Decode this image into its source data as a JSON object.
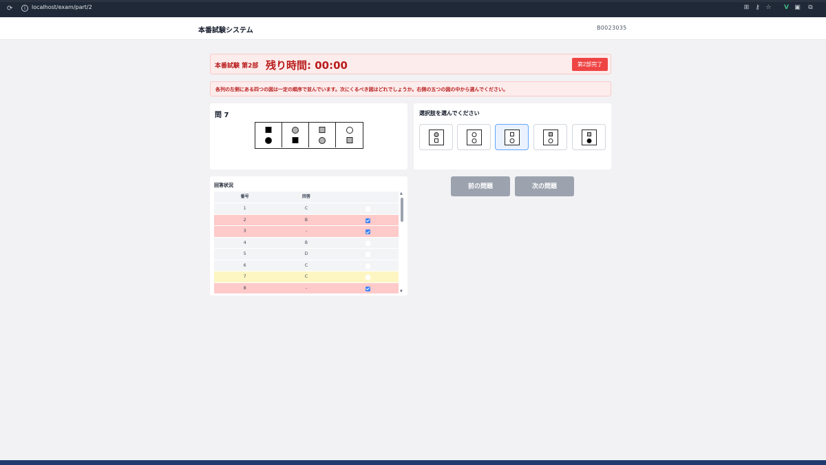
{
  "browser": {
    "url": "localhost/exam/part/2",
    "extensions": [
      "translate-icon",
      "key-icon",
      "star-icon",
      "vue-devtools-icon",
      "extension-icon",
      "puzzle-icon"
    ]
  },
  "header": {
    "title": "本番試験システム",
    "user_id": "B0023035"
  },
  "timer": {
    "part_label": "本番試験 第2部",
    "remaining": "残り時間: 00:00",
    "finish_button": "第2部完了"
  },
  "instruction": "各列の左側にある四つの図は一定の順序で並んでいます。次にくるべき図はどれでしょうか。右側の五つの図の中から選んでください。",
  "question": {
    "number_label": "問 7",
    "cells": [
      {
        "top": {
          "shape": "square",
          "fill": "black"
        },
        "bottom": {
          "shape": "circle",
          "fill": "black"
        }
      },
      {
        "top": {
          "shape": "circle",
          "fill": "gray"
        },
        "bottom": {
          "shape": "square",
          "fill": "black"
        }
      },
      {
        "top": {
          "shape": "square",
          "fill": "gray"
        },
        "bottom": {
          "shape": "circle",
          "fill": "gray"
        }
      },
      {
        "top": {
          "shape": "circle",
          "fill": "white"
        },
        "bottom": {
          "shape": "square",
          "fill": "gray"
        }
      }
    ]
  },
  "options": {
    "title": "選択肢を選んでください",
    "selected_index": 2,
    "items": [
      {
        "top": {
          "shape": "circle",
          "fill": "gray"
        },
        "bottom": {
          "shape": "square",
          "fill": "white"
        }
      },
      {
        "top": {
          "shape": "circle",
          "fill": "white"
        },
        "bottom": {
          "shape": "circle",
          "fill": "white"
        }
      },
      {
        "top": {
          "shape": "square",
          "fill": "white"
        },
        "bottom": {
          "shape": "circle",
          "fill": "white"
        }
      },
      {
        "top": {
          "shape": "square",
          "fill": "gray"
        },
        "bottom": {
          "shape": "circle",
          "fill": "white"
        }
      },
      {
        "top": {
          "shape": "square",
          "fill": "gray"
        },
        "bottom": {
          "shape": "circle",
          "fill": "black"
        }
      }
    ]
  },
  "nav": {
    "prev": "前の問題",
    "next": "次の問題"
  },
  "status": {
    "title": "回答状況",
    "columns": [
      "番号",
      "回答",
      ""
    ],
    "rows": [
      {
        "no": "1",
        "answer": "C",
        "flagged": false,
        "state": "normal"
      },
      {
        "no": "2",
        "answer": "B",
        "flagged": true,
        "state": "flagged"
      },
      {
        "no": "3",
        "answer": "-",
        "flagged": true,
        "state": "flagged"
      },
      {
        "no": "4",
        "answer": "B",
        "flagged": false,
        "state": "normal"
      },
      {
        "no": "5",
        "answer": "D",
        "flagged": false,
        "state": "normal"
      },
      {
        "no": "6",
        "answer": "C",
        "flagged": false,
        "state": "normal"
      },
      {
        "no": "7",
        "answer": "C",
        "flagged": false,
        "state": "current"
      },
      {
        "no": "8",
        "answer": "-",
        "flagged": true,
        "state": "flagged"
      }
    ]
  },
  "colors": {
    "alert_text": "#b91c1c",
    "alert_bg": "#fdecec",
    "finish_button": "#ef4444",
    "nav_button": "#9ca3af",
    "selected_border": "#60a5fa",
    "flag_row": "#fecaca",
    "current_row": "#fdf6c3"
  }
}
